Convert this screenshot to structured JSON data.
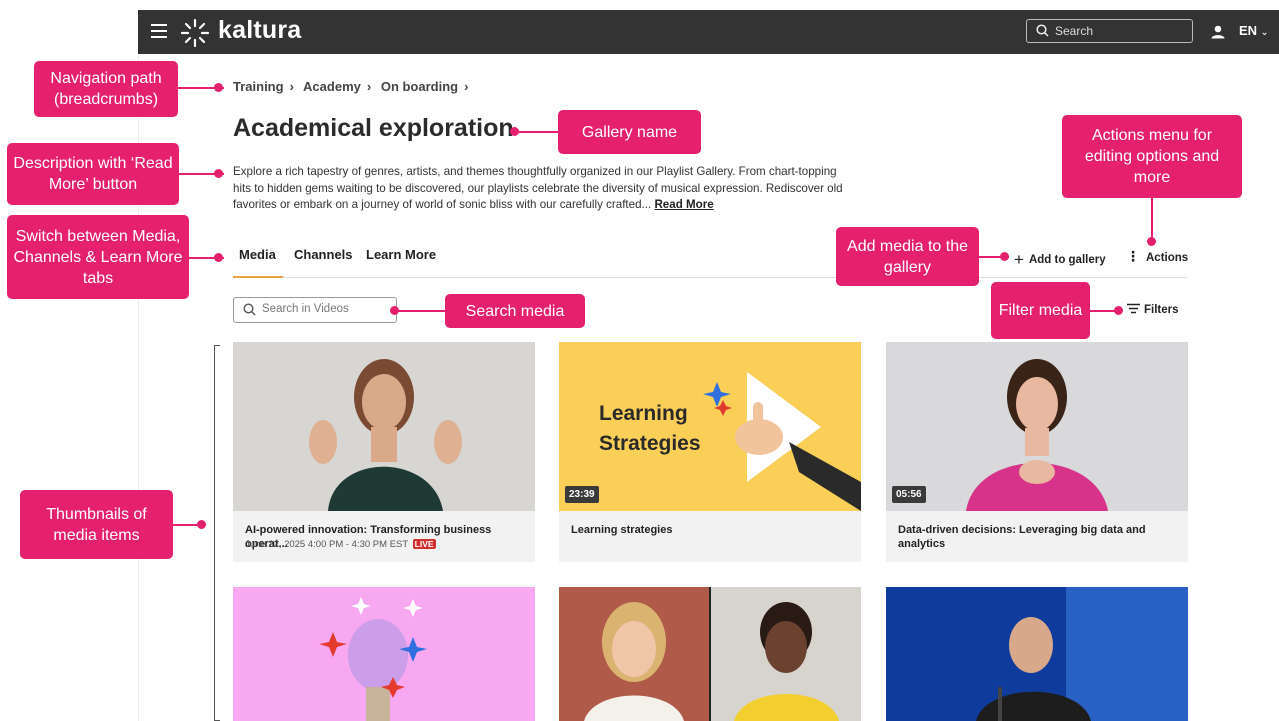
{
  "app": {
    "brand": "kaltura",
    "search_placeholder": "Search",
    "language": "EN"
  },
  "breadcrumb": {
    "items": [
      "Training",
      "Academy",
      "On boarding"
    ],
    "separator": "›"
  },
  "gallery": {
    "title": "Academical exploration",
    "description": "Explore a rich tapestry of genres, artists, and themes thoughtfully organized in our Playlist Gallery. From chart-topping hits to hidden gems waiting to be discovered, our playlists celebrate the diversity of musical expression. Rediscover old favorites or embark on a journey of world of sonic bliss with our carefully crafted...",
    "read_more": "Read More"
  },
  "tabs": [
    {
      "label": "Media",
      "active": true
    },
    {
      "label": "Channels",
      "active": false
    },
    {
      "label": "Learn More",
      "active": false
    }
  ],
  "toolbar": {
    "add_to_gallery": "Add to gallery",
    "actions": "Actions",
    "filters": "Filters"
  },
  "media_search": {
    "placeholder": "Search in Videos"
  },
  "cards": [
    {
      "title": "AI-powered innovation: Transforming business operat...",
      "meta": "June 22, 2025 4:00 PM - 4:30 PM EST",
      "badge": "LIVE",
      "duration": ""
    },
    {
      "title": "Learning strategies",
      "meta": "",
      "badge": "",
      "duration": "23:39",
      "thumb_text": [
        "Learning",
        "Strategies"
      ]
    },
    {
      "title": "Data-driven decisions: Leveraging big data and analytics",
      "meta": "",
      "badge": "",
      "duration": "05:56"
    },
    {
      "title": "",
      "meta": "",
      "badge": "",
      "duration": ""
    },
    {
      "title": "",
      "meta": "",
      "badge": "",
      "duration": ""
    },
    {
      "title": "",
      "meta": "",
      "badge": "",
      "duration": ""
    }
  ],
  "callouts": {
    "breadcrumbs": "Navigation path (breadcrumbs)",
    "gallery_name": "Gallery name",
    "description": "Description with ‘Read More’ button",
    "actions_menu": "Actions menu for editing options and more",
    "tabs": "Switch between Media, Channels & Learn More tabs",
    "add_media": "Add media to the gallery",
    "search_media": "Search media",
    "filter_media": "Filter media",
    "thumbnails": "Thumbnails of media items"
  },
  "colors": {
    "accent": "#e5216f",
    "topbar": "#333333",
    "tab_underline": "#e9a040",
    "live": "#d32f2f"
  }
}
